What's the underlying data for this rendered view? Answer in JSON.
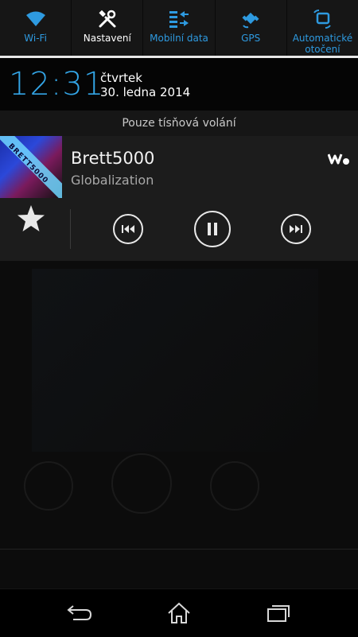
{
  "quick_settings": [
    {
      "label": "Wi-Fi",
      "icon": "wifi-icon",
      "active": true
    },
    {
      "label": "Nastavení",
      "icon": "settings-tools-icon",
      "active": false
    },
    {
      "label": "Mobilní data",
      "icon": "mobile-data-icon",
      "active": true
    },
    {
      "label": "GPS",
      "icon": "gps-icon",
      "active": true
    },
    {
      "label": "Automatické otočení",
      "icon": "auto-rotate-icon",
      "active": true
    }
  ],
  "clock": {
    "time": "12:31",
    "day": "čtvrtek",
    "date": "30. ledna 2014"
  },
  "status": {
    "emergency_text": "Pouze tísňová volání"
  },
  "music": {
    "title": "Brett5000",
    "artist": "Globalization",
    "album_art_text": "BRETT5000",
    "app_icon": "walkman-icon",
    "controls": [
      "previous-icon",
      "pause-icon",
      "next-icon"
    ],
    "favorite_icon": "star-icon"
  },
  "colors": {
    "accent": "#33a5e6",
    "qs_active": "#2e9ae0",
    "panel": "#1c1c1c"
  },
  "nav": {
    "buttons": [
      "back-icon",
      "home-icon",
      "recent-apps-icon"
    ]
  }
}
